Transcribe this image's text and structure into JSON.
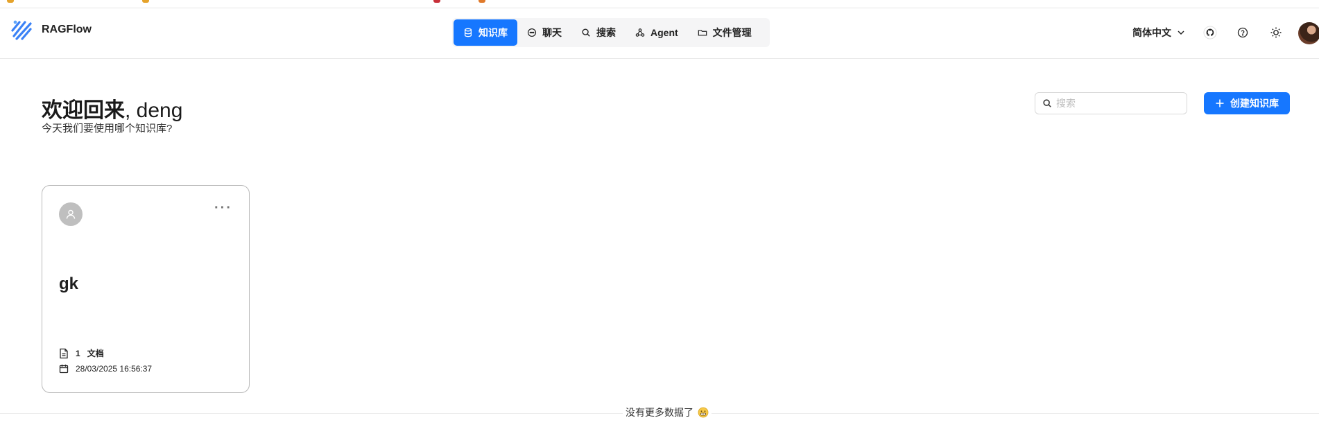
{
  "app": {
    "brand": "RAGFlow"
  },
  "nav": {
    "items": [
      {
        "label": "知识库",
        "icon": "database-icon",
        "active": true
      },
      {
        "label": "聊天",
        "icon": "chat-icon",
        "active": false
      },
      {
        "label": "搜索",
        "icon": "search-icon",
        "active": false
      },
      {
        "label": "Agent",
        "icon": "agent-icon",
        "active": false
      },
      {
        "label": "文件管理",
        "icon": "folder-icon",
        "active": false
      }
    ]
  },
  "header": {
    "language": "简体中文",
    "icons": [
      "github-icon",
      "help-icon",
      "theme-sun-icon"
    ]
  },
  "page": {
    "welcome": "欢迎回来",
    "username": ", deng",
    "subtitle": "今天我们要使用哪个知识库?",
    "search_placeholder": "搜索",
    "create_label": "创建知识库"
  },
  "knowledge_bases": [
    {
      "name": "gk",
      "doc_count": "1",
      "doc_label": "文档",
      "updated": "28/03/2025 16:56:37"
    }
  ],
  "footer": {
    "no_more": "没有更多数据了"
  },
  "colors": {
    "accent": "#1677ff",
    "nav_bg": "#f5f5f6",
    "card_border": "#b9b9b9"
  }
}
